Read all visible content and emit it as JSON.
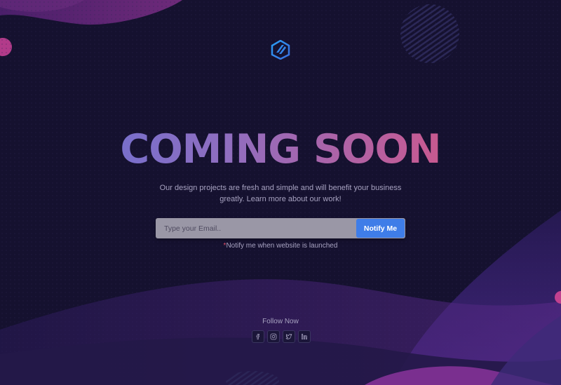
{
  "hero": {
    "headline": "COMING SOON",
    "description_line1": "Our design projects are fresh and simple and will benefit your business",
    "description_line2": "greatly. Learn more about our work!"
  },
  "subscribe": {
    "email_placeholder": "Type your Email..",
    "email_value": "",
    "button_label": "Notify Me",
    "note_asterisk": "*",
    "note_text": "Notify me when website is launched"
  },
  "follow": {
    "title": "Follow Now",
    "icons": [
      "facebook-icon",
      "instagram-icon",
      "twitter-icon",
      "linkedin-icon"
    ]
  },
  "colors": {
    "background": "#15112f",
    "accent_blue": "#3f7de8",
    "gradient_start": "#5f70d8",
    "gradient_end": "#e2516a",
    "asterisk": "#e2516a"
  }
}
